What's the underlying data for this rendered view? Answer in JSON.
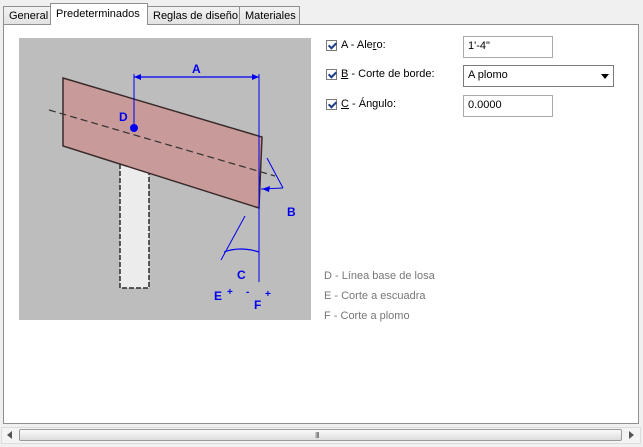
{
  "tabs": [
    {
      "label": "General"
    },
    {
      "label": "Predeterminados"
    },
    {
      "label": "Reglas de diseño"
    },
    {
      "label": "Materiales"
    }
  ],
  "diagram": {
    "labels": {
      "a": "A",
      "b": "B",
      "c": "C",
      "d": "D",
      "e": "E",
      "f": "F",
      "plus": "+",
      "minus": "-"
    },
    "colors": {
      "background": "#bdbdbd",
      "slab": "#c99a9a",
      "dimension": "#0000ee"
    }
  },
  "fields": {
    "a": {
      "checked": true,
      "label_pre": "A - Ale",
      "label_underline": "r",
      "label_post": "o:",
      "value": "1'-4\""
    },
    "b": {
      "checked": true,
      "label_underline": "B",
      "label_post": " - Corte de borde:",
      "value": "A plomo"
    },
    "c": {
      "checked": true,
      "label_underline": "C",
      "label_post": " - Ángulo:",
      "value": "0.0000"
    }
  },
  "legend": [
    {
      "text": "D - Línea base de losa"
    },
    {
      "text": "E - Corte a escuadra"
    },
    {
      "text": "F - Corte a plomo"
    }
  ],
  "scrollbar": {
    "grip": "III"
  }
}
